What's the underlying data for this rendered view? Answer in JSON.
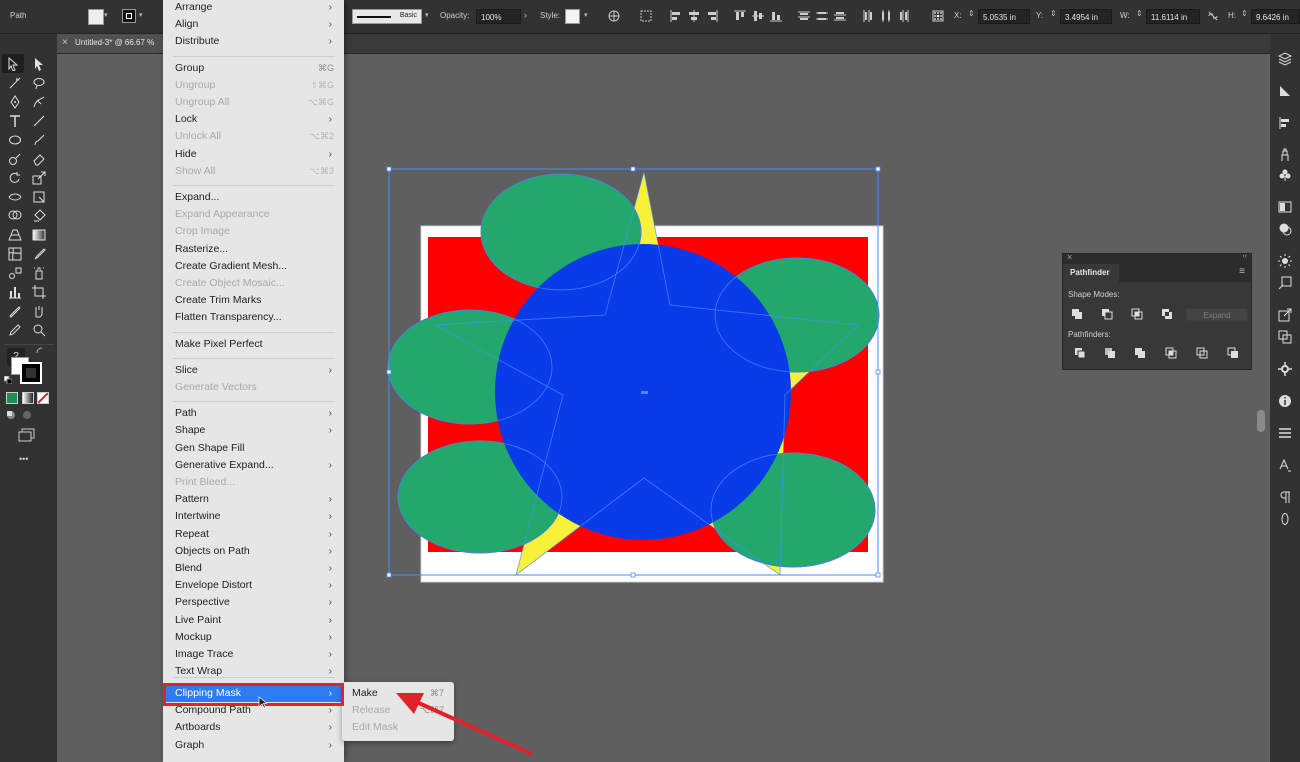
{
  "control_bar": {
    "selection": "Path",
    "stroke_style": "Basic",
    "opacity_label": "Opacity:",
    "opacity_value": "100%",
    "style_label": "Style:",
    "x_label": "X:",
    "x_value": "5.0535 in",
    "y_label": "Y:",
    "y_value": "3.4954 in",
    "w_label": "W:",
    "w_value": "11.6114 in",
    "h_label": "H:",
    "h_value": "9.6426 in"
  },
  "document": {
    "tab_title": "Untitled-3* @ 66.67 %",
    "close_glyph": "×"
  },
  "menu": {
    "items": [
      {
        "label": "Arrange",
        "arrow": "›"
      },
      {
        "label": "Align",
        "arrow": "›"
      },
      {
        "label": "Distribute",
        "arrow": "›"
      },
      {
        "label": "Group",
        "shortcut": "⌘G"
      },
      {
        "label": "Ungroup",
        "shortcut": "⇧⌘G",
        "disabled": true
      },
      {
        "label": "Ungroup All",
        "shortcut": "⌥⌘G",
        "disabled": true
      },
      {
        "label": "Lock",
        "arrow": "›"
      },
      {
        "label": "Unlock All",
        "shortcut": "⌥⌘2",
        "disabled": true
      },
      {
        "label": "Hide",
        "arrow": "›"
      },
      {
        "label": "Show All",
        "shortcut": "⌥⌘3",
        "disabled": true
      },
      {
        "label": "Expand..."
      },
      {
        "label": "Expand Appearance",
        "disabled": true
      },
      {
        "label": "Crop Image",
        "disabled": true
      },
      {
        "label": "Rasterize..."
      },
      {
        "label": "Create Gradient Mesh..."
      },
      {
        "label": "Create Object Mosaic...",
        "disabled": true
      },
      {
        "label": "Create Trim Marks"
      },
      {
        "label": "Flatten Transparency..."
      },
      {
        "label": "Make Pixel Perfect"
      },
      {
        "label": "Slice",
        "arrow": "›"
      },
      {
        "label": "Generate Vectors",
        "disabled": true
      },
      {
        "label": "Path",
        "arrow": "›"
      },
      {
        "label": "Shape",
        "arrow": "›"
      },
      {
        "label": "Gen Shape Fill"
      },
      {
        "label": "Generative Expand...",
        "arrow": "›"
      },
      {
        "label": "Print Bleed...",
        "disabled": true
      },
      {
        "label": "Pattern",
        "arrow": "›"
      },
      {
        "label": "Intertwine",
        "arrow": "›"
      },
      {
        "label": "Repeat",
        "arrow": "›"
      },
      {
        "label": "Objects on Path",
        "arrow": "›"
      },
      {
        "label": "Blend",
        "arrow": "›"
      },
      {
        "label": "Envelope Distort",
        "arrow": "›"
      },
      {
        "label": "Perspective",
        "arrow": "›"
      },
      {
        "label": "Live Paint",
        "arrow": "›"
      },
      {
        "label": "Mockup",
        "arrow": "›"
      },
      {
        "label": "Image Trace",
        "arrow": "›"
      },
      {
        "label": "Text Wrap",
        "arrow": "›"
      },
      {
        "label": "Clipping Mask",
        "arrow": "›",
        "highlighted": true
      },
      {
        "label": "Compound Path",
        "arrow": "›"
      },
      {
        "label": "Artboards",
        "arrow": "›"
      },
      {
        "label": "Graph",
        "arrow": "›"
      }
    ]
  },
  "submenu": {
    "items": [
      {
        "label": "Make",
        "shortcut": "⌘7"
      },
      {
        "label": "Release",
        "shortcut": "⌥⌘7",
        "disabled": true
      },
      {
        "label": "Edit Mask",
        "disabled": true
      }
    ]
  },
  "pathfinder": {
    "title": "Pathfinder",
    "shape_modes_label": "Shape Modes:",
    "pathfinders_label": "Pathfinders:",
    "expand_label": "Expand",
    "close_glyph": "×",
    "collapse_glyph": "‹‹",
    "menu_glyph": "≡"
  },
  "toolbar": {
    "unknown_tool_glyph": "?",
    "more_glyph": "•••"
  },
  "colors": {
    "highlight_blue": "#2f7cf1",
    "annotation_red": "#e0232b",
    "art_red": "#ff0000",
    "art_blue": "#0a3be8",
    "art_green": "#22a86a",
    "art_yellow": "#f8f13a",
    "selection_blue": "#4a8cff"
  }
}
